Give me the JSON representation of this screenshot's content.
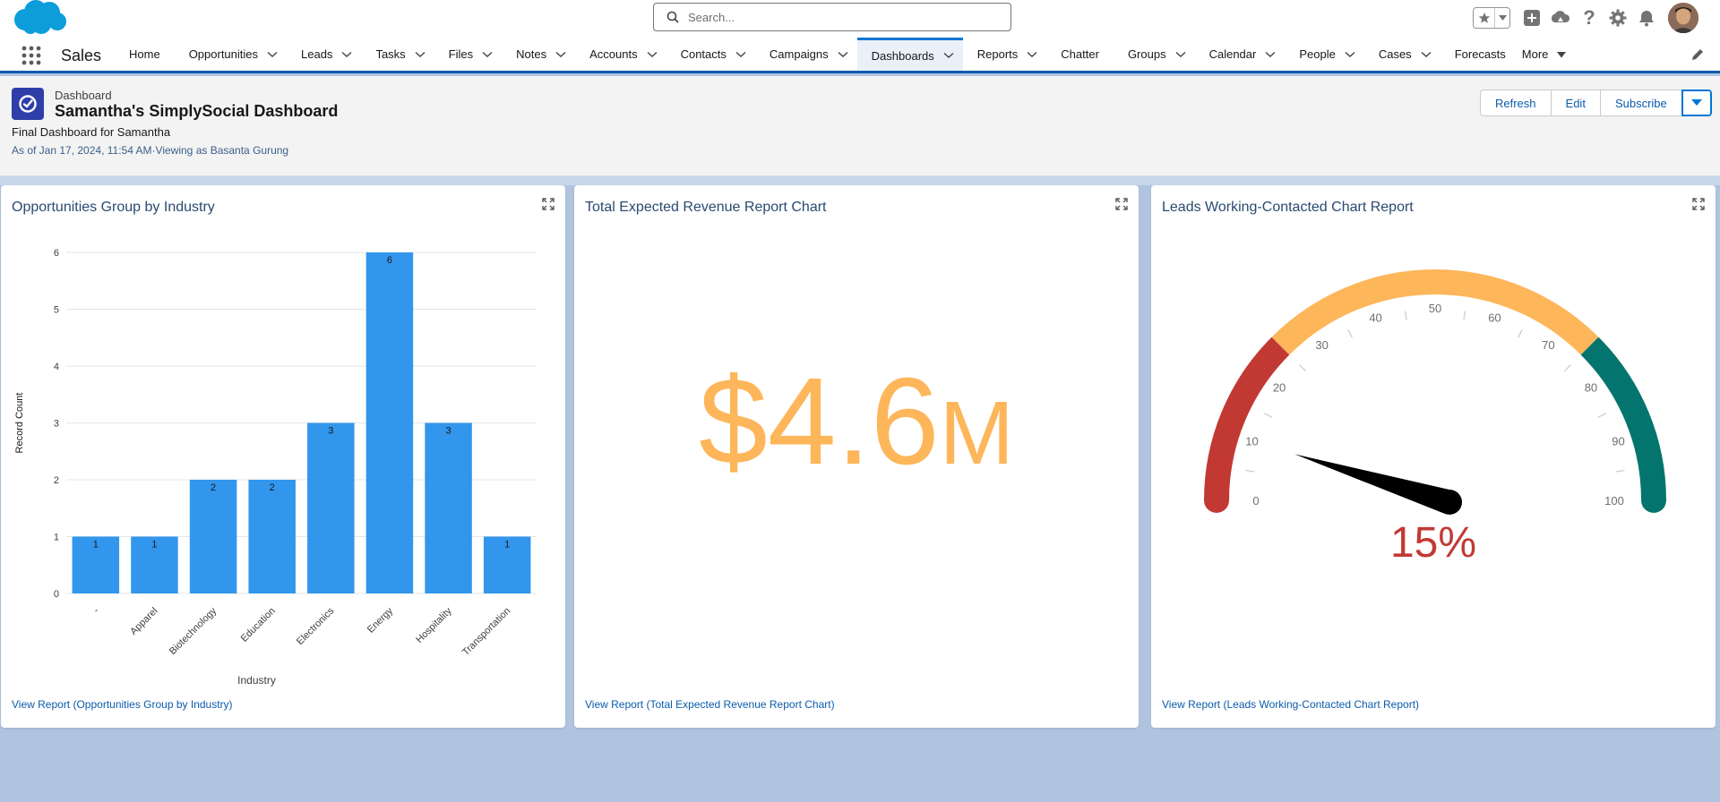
{
  "header": {
    "search_placeholder": "Search...",
    "icons": [
      "favorites-star-icon",
      "chevron-down-icon",
      "global-actions-plus-icon",
      "trailhead-icon",
      "help-icon",
      "setup-gear-icon",
      "notifications-bell-icon"
    ]
  },
  "nav": {
    "app_name": "Sales",
    "items": [
      {
        "label": "Home",
        "chevron": false
      },
      {
        "label": "Opportunities",
        "chevron": true
      },
      {
        "label": "Leads",
        "chevron": true
      },
      {
        "label": "Tasks",
        "chevron": true
      },
      {
        "label": "Files",
        "chevron": true
      },
      {
        "label": "Notes",
        "chevron": true
      },
      {
        "label": "Accounts",
        "chevron": true
      },
      {
        "label": "Contacts",
        "chevron": true
      },
      {
        "label": "Campaigns",
        "chevron": true
      },
      {
        "label": "Dashboards",
        "chevron": true,
        "active": true
      },
      {
        "label": "Reports",
        "chevron": true
      },
      {
        "label": "Chatter",
        "chevron": false
      },
      {
        "label": "Groups",
        "chevron": true
      },
      {
        "label": "Calendar",
        "chevron": true
      },
      {
        "label": "People",
        "chevron": true
      },
      {
        "label": "Cases",
        "chevron": true
      },
      {
        "label": "Forecasts",
        "chevron": false
      }
    ],
    "more_label": "More"
  },
  "dashboard": {
    "type_label": "Dashboard",
    "title": "Samantha's SimplySocial Dashboard",
    "subtitle": "Final Dashboard for Samantha",
    "as_of": "As of Jan 17, 2024, 11:54 AM·Viewing as Basanta Gurung",
    "buttons": {
      "refresh": "Refresh",
      "edit": "Edit",
      "subscribe": "Subscribe"
    }
  },
  "widgets": {
    "w1": {
      "title": "Opportunities Group by Industry",
      "link": "View Report (Opportunities Group by Industry)"
    },
    "w2": {
      "title": "Total Expected Revenue Report Chart",
      "link": "View Report (Total Expected Revenue Report Chart)",
      "metric": "$4.6",
      "metric_suffix": "M",
      "color": "#fdb65a"
    },
    "w3": {
      "title": "Leads Working-Contacted Chart Report",
      "link": "View Report (Leads Working-Contacted Chart Report)",
      "value_label": "15%"
    }
  },
  "chart_data": [
    {
      "type": "bar",
      "categories": [
        "-",
        "Apparel",
        "Biotechnology",
        "Education",
        "Electronics",
        "Energy",
        "Hospitality",
        "Transportation"
      ],
      "values": [
        1,
        1,
        2,
        2,
        3,
        6,
        3,
        1
      ],
      "xlabel": "Industry",
      "ylabel": "Record Count",
      "ylim": [
        0,
        6
      ],
      "yticks": [
        0,
        1,
        2,
        3,
        4,
        5,
        6
      ],
      "color": "#3296ed",
      "grid": true
    },
    {
      "type": "gauge",
      "value": 15,
      "range": [
        0,
        100
      ],
      "tick_labels": [
        0,
        10,
        20,
        30,
        40,
        50,
        60,
        70,
        80,
        90,
        100
      ],
      "segments": [
        {
          "from": 0,
          "to": 25,
          "color": "#c23934"
        },
        {
          "from": 25,
          "to": 75,
          "color": "#fdb65a"
        },
        {
          "from": 75,
          "to": 100,
          "color": "#04756e"
        }
      ],
      "needle_color": "#000000"
    }
  ]
}
